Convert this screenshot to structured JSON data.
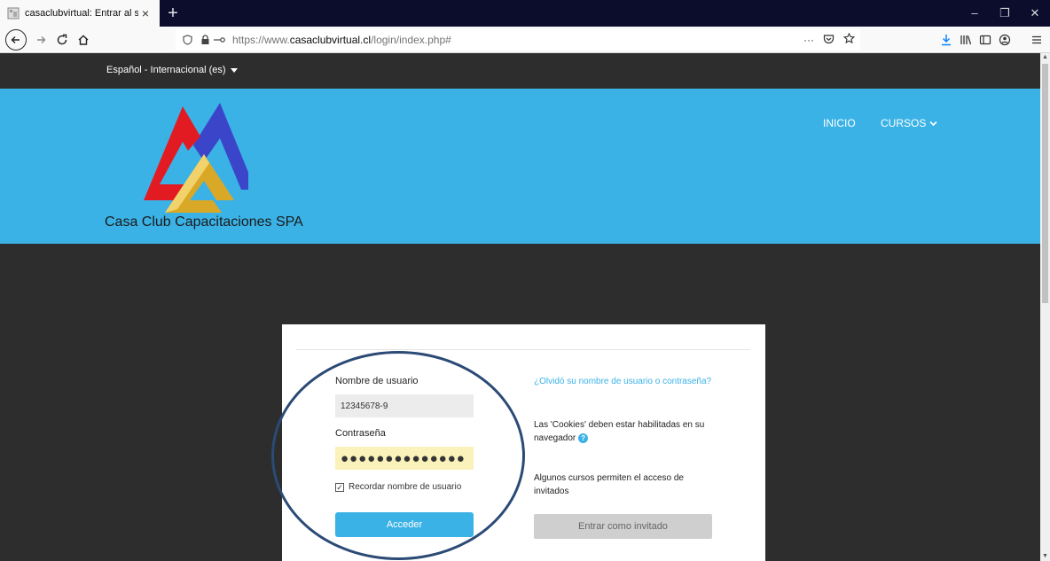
{
  "browser": {
    "tab_title": "casaclubvirtual: Entrar al sitio",
    "tab_close": "×",
    "new_tab": "+",
    "url_prefix": "https://www.",
    "url_domain": "casaclubvirtual.cl",
    "url_path": "/login/index.php#",
    "url_more": "···",
    "window_controls": [
      "–",
      "❐",
      "✕"
    ]
  },
  "page": {
    "language": "Español - Internacional (es)",
    "site_name": "Casa Club Capacitaciones SPA",
    "menu": {
      "home": "INICIO",
      "courses": "CURSOS"
    },
    "login": {
      "username_label": "Nombre de usuario",
      "username_value": "12345678-9",
      "password_label": "Contraseña",
      "password_mask": "●●●●●●●●●●●●●●",
      "remember_label": "Recordar nombre de usuario",
      "submit_label": "Acceder",
      "forgot_link": "¿Olvidó su nombre de usuario o contraseña?",
      "cookies_note": "Las 'Cookies' deben estar habilitadas en su navegador",
      "guest_note": "Algunos cursos permiten el acceso de invitados",
      "guest_button": "Entrar como invitado"
    }
  },
  "colors": {
    "header_bg": "#3bb2e6",
    "page_bg": "#2d2d2d",
    "annotation": "#2b4a75"
  }
}
